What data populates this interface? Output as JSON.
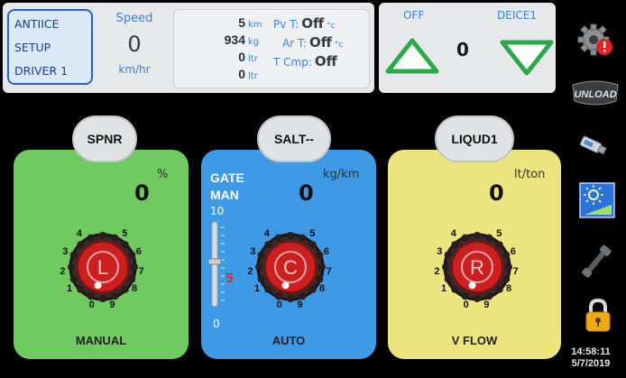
{
  "status": {
    "mode_lines": [
      "ANTIICE",
      "SETUP",
      "DRIVER 1"
    ],
    "speed_label": "Speed",
    "speed_value": "0",
    "speed_unit": "km/hr",
    "totals": [
      {
        "value": "5",
        "unit": "km"
      },
      {
        "value": "934",
        "unit": "kg"
      },
      {
        "value": "0",
        "unit": "ltr"
      },
      {
        "value": "0",
        "unit": "ltr"
      }
    ],
    "temps": [
      {
        "label": "Pv T:",
        "value": "Off",
        "unit": "°c"
      },
      {
        "label": "Ar T:",
        "value": "Off",
        "unit": "°c"
      },
      {
        "label": "T Cmp:",
        "value": "Off",
        "unit": ""
      }
    ]
  },
  "deice": {
    "off_label": "OFF",
    "name": "DEICE1",
    "value": "0"
  },
  "panels": {
    "spinner": {
      "title": "SPNR",
      "unit": "%",
      "value": "0",
      "dial_letter": "L",
      "dial_level": 0,
      "mode": "MANUAL",
      "color": "#6fcb5f"
    },
    "salt": {
      "title": "SALT--",
      "unit": "kg/km",
      "value": "0",
      "dial_letter": "C",
      "dial_level": 0,
      "mode": "AUTO",
      "gate_label": "GATE",
      "gate_mode": "MAN",
      "gate_max": "10",
      "gate_min": "0",
      "gate_value": "5",
      "color": "#3e99e6"
    },
    "liquid": {
      "title": "LIQUD1",
      "unit": "lt/ton",
      "value": "0",
      "dial_letter": "R",
      "dial_level": 0,
      "mode": "V FLOW",
      "color": "#ece57d"
    }
  },
  "dial_ticks": [
    "0",
    "1",
    "2",
    "3",
    "4",
    "5",
    "6",
    "7",
    "8",
    "9"
  ],
  "sidebar": [
    "settings-alert-icon",
    "unload-icon",
    "usb-drive-icon",
    "brightness-icon",
    "wrench-icon",
    "lock-icon"
  ],
  "clock": {
    "time": "14:58:11",
    "date": "5/7/2019"
  }
}
